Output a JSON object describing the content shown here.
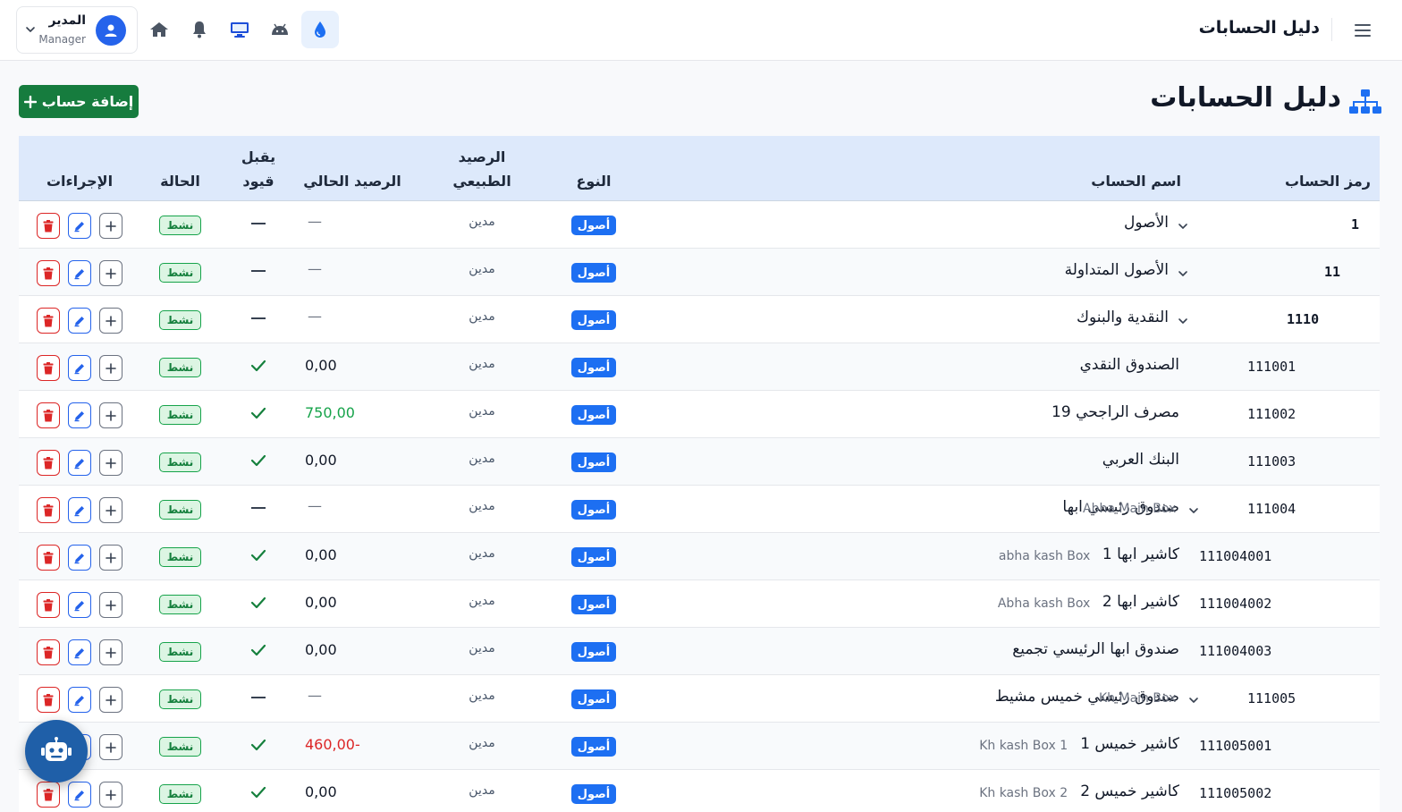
{
  "topbar": {
    "title": "دليل الحسابات",
    "user": {
      "name": "المدير",
      "role": "Manager"
    },
    "nav_icons": [
      "water-drop-icon",
      "android-icon",
      "desktop-icon",
      "bell-icon",
      "home-icon"
    ]
  },
  "page": {
    "title": "دليل الحسابات",
    "add_button": "إضافة حساب"
  },
  "table": {
    "headers": {
      "code": "رمز الحساب",
      "name": "اسم الحساب",
      "type": "النوع",
      "natural_1": "الرصيد",
      "natural_2": "الطبيعي",
      "balance": "الرصيد الحالي",
      "posting_1": "يقبل",
      "posting_2": "قيود",
      "status": "الحالة",
      "actions": "الإجراءات"
    },
    "rows": [
      {
        "code": "1",
        "name": "الأصول",
        "eng": "",
        "type": "أصول",
        "natural": "مدين",
        "balance": "—",
        "posting": "dash",
        "status": "نشط",
        "level": 0,
        "expandable": true
      },
      {
        "code": "11",
        "name": "الأصول المتداولة",
        "eng": "",
        "type": "أصول",
        "natural": "مدين",
        "balance": "—",
        "posting": "dash",
        "status": "نشط",
        "level": 1,
        "expandable": true
      },
      {
        "code": "1110",
        "name": "النقدية والبنوك",
        "eng": "",
        "type": "أصول",
        "natural": "مدين",
        "balance": "—",
        "posting": "dash",
        "status": "نشط",
        "level": 2,
        "expandable": true
      },
      {
        "code": "111001",
        "name": "الصندوق النقدي",
        "eng": "",
        "type": "أصول",
        "natural": "مدين",
        "balance": "0,00",
        "posting": "check",
        "status": "نشط",
        "level": 3,
        "expandable": false
      },
      {
        "code": "111002",
        "name": "مصرف الراجحي 19",
        "eng": "",
        "type": "أصول",
        "natural": "مدين",
        "balance": "750,00",
        "posting": "check",
        "status": "نشط",
        "level": 3,
        "expandable": false
      },
      {
        "code": "111003",
        "name": "البنك العربي",
        "eng": "",
        "type": "أصول",
        "natural": "مدين",
        "balance": "0,00",
        "posting": "check",
        "status": "نشط",
        "level": 3,
        "expandable": false
      },
      {
        "code": "111004",
        "name": "صندوق رئيسي ابها",
        "eng": "Abha Main Box",
        "type": "أصول",
        "natural": "مدين",
        "balance": "—",
        "posting": "dash",
        "status": "نشط",
        "level": 3,
        "expandable": true
      },
      {
        "code": "111004001",
        "name": "كاشير ابها 1",
        "eng": "abha kash Box",
        "type": "أصول",
        "natural": "مدين",
        "balance": "0,00",
        "posting": "check",
        "status": "نشط",
        "level": 4,
        "expandable": false
      },
      {
        "code": "111004002",
        "name": "كاشير ابها 2",
        "eng": "Abha kash Box",
        "type": "أصول",
        "natural": "مدين",
        "balance": "0,00",
        "posting": "check",
        "status": "نشط",
        "level": 4,
        "expandable": false
      },
      {
        "code": "111004003",
        "name": "صندوق ابها الرئيسي تجميع",
        "eng": "",
        "type": "أصول",
        "natural": "مدين",
        "balance": "0,00",
        "posting": "check",
        "status": "نشط",
        "level": 4,
        "expandable": false
      },
      {
        "code": "111005",
        "name": "صندوق رئيسي خميس مشيط",
        "eng": "Kh Main Box",
        "type": "أصول",
        "natural": "مدين",
        "balance": "—",
        "posting": "dash",
        "status": "نشط",
        "level": 3,
        "expandable": true
      },
      {
        "code": "111005001",
        "name": "كاشير خميس 1",
        "eng": "Kh kash Box 1",
        "type": "أصول",
        "natural": "مدين",
        "balance": "460,00-",
        "posting": "check",
        "status": "نشط",
        "level": 4,
        "expandable": false
      },
      {
        "code": "111005002",
        "name": "كاشير خميس 2",
        "eng": "Kh kash Box 2",
        "type": "أصول",
        "natural": "مدين",
        "balance": "0,00",
        "posting": "check",
        "status": "نشط",
        "level": 4,
        "expandable": false
      }
    ]
  },
  "colors": {
    "primary": "#1d6ff2",
    "success": "#167c3e",
    "danger": "#dc2626",
    "header_bg": "#dde9fb"
  },
  "assistant": {
    "icon": "robot-icon"
  }
}
